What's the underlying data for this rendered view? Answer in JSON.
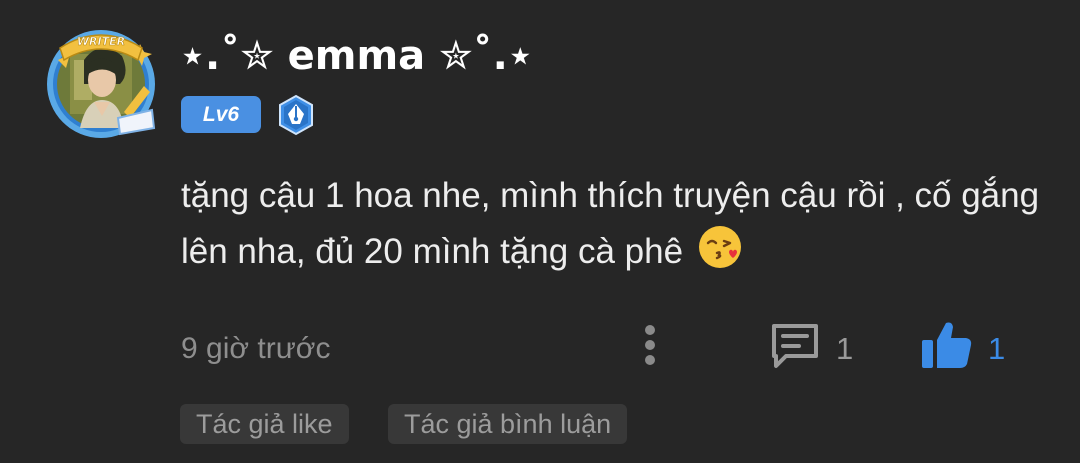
{
  "user": {
    "name": "⋆.˚✮ emma ✮˚.⋆",
    "level": "Lv6",
    "avatar_frame_label": "WRITER"
  },
  "comment": {
    "text": "tặng cậu 1 hoa nhe, mình thích truyện cậu rồi , cố gắng lên nha, đủ 20 mình tặng cà phê",
    "emoji": "kissing-face-emoji"
  },
  "meta": {
    "timestamp": "9 giờ trước",
    "reply_count": "1",
    "like_count": "1"
  },
  "tags": {
    "author_like": "Tác giả like",
    "author_comment": "Tác giả bình luận"
  },
  "colors": {
    "background": "#262626",
    "accent_blue": "#3b8be6",
    "level_badge": "#4a90e2",
    "tag_background": "#383838"
  }
}
